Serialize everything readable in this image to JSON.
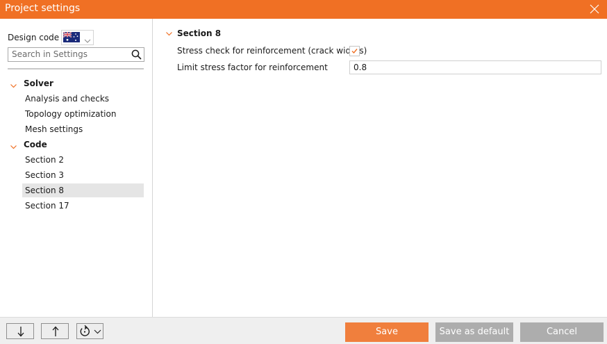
{
  "window": {
    "title": "Project settings"
  },
  "sidebar": {
    "design_code_label": "Design code",
    "design_code_flag": "australia-flag-icon",
    "search_placeholder": "Search in Settings",
    "tree": {
      "solver": {
        "label": "Solver",
        "items": [
          "Analysis and checks",
          "Topology optimization",
          "Mesh settings"
        ]
      },
      "code": {
        "label": "Code",
        "items": [
          "Section 2",
          "Section 3",
          "Section 8",
          "Section 17"
        ]
      }
    },
    "selected_item": "Section 8"
  },
  "main": {
    "section_title": "Section 8",
    "properties": [
      {
        "label": "Stress check for reinforcement (crack widths)",
        "type": "checkbox",
        "checked": true
      },
      {
        "label": "Limit stress factor for reinforcement",
        "type": "text",
        "value": "0.8"
      }
    ]
  },
  "footer": {
    "icons": [
      "arrow-down-icon",
      "arrow-up-icon",
      "reset-icon"
    ],
    "save_label": "Save",
    "save_default_label": "Save as default",
    "cancel_label": "Cancel"
  },
  "colors": {
    "accent": "#f07024",
    "primary_button": "#f07f3d",
    "disabled_button": "#adadad",
    "selection": "#e5e5e5"
  }
}
